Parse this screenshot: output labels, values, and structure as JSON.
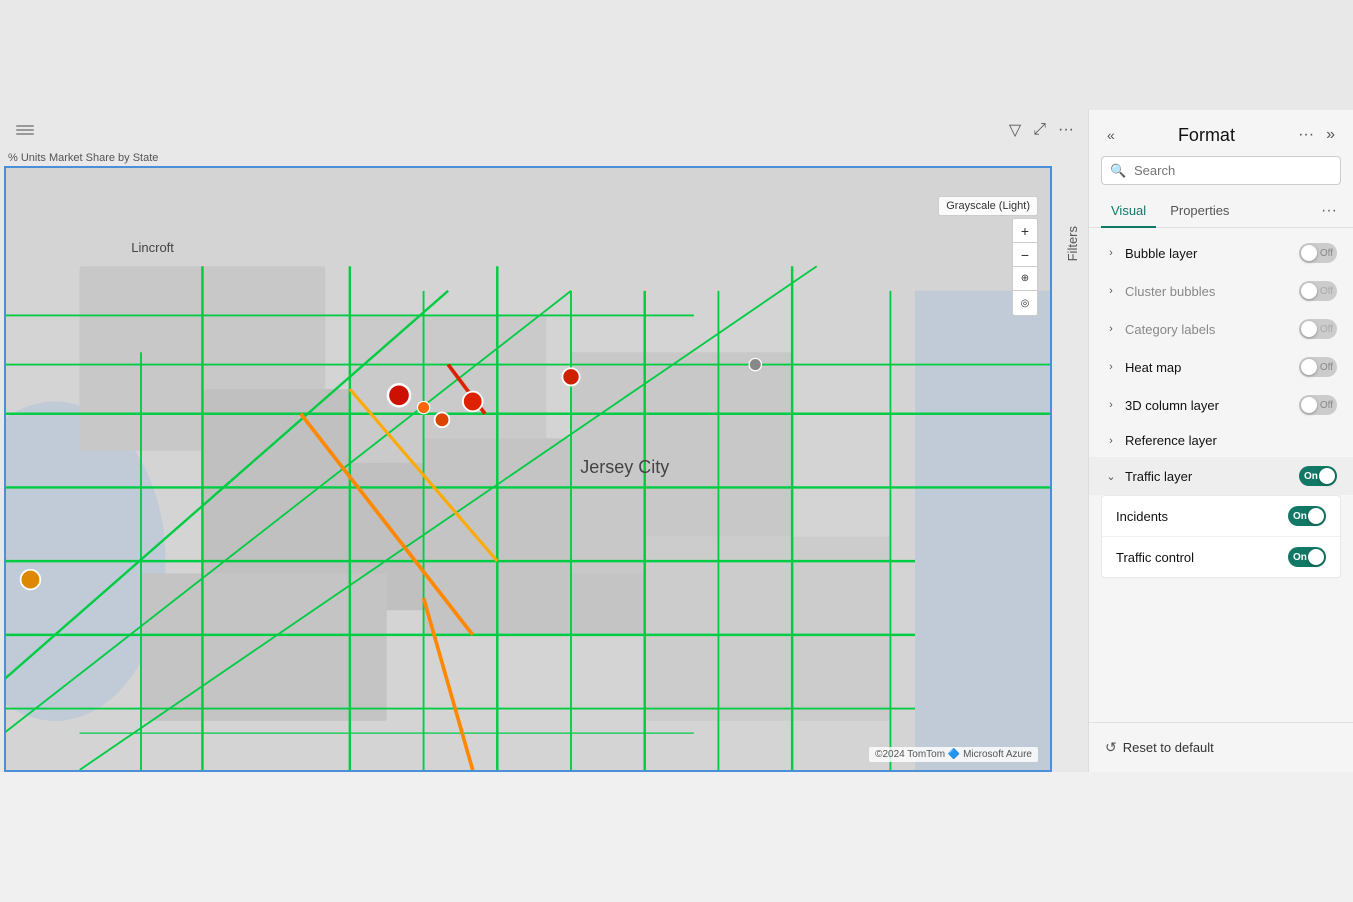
{
  "format_panel": {
    "title": "Format",
    "search_placeholder": "Search",
    "tabs": [
      {
        "id": "visual",
        "label": "Visual",
        "active": true
      },
      {
        "id": "properties",
        "label": "Properties",
        "active": false
      }
    ],
    "tab_more": "···",
    "layers": [
      {
        "id": "bubble_layer",
        "name": "Bubble layer",
        "state": "off",
        "expanded": false,
        "dimmed": false
      },
      {
        "id": "cluster_bubbles",
        "name": "Cluster bubbles",
        "state": "off",
        "expanded": false,
        "dimmed": true
      },
      {
        "id": "category_labels",
        "name": "Category labels",
        "state": "off",
        "expanded": false,
        "dimmed": true
      },
      {
        "id": "heat_map",
        "name": "Heat map",
        "state": "off",
        "expanded": false,
        "dimmed": false
      },
      {
        "id": "3d_column_layer",
        "name": "3D column layer",
        "state": "off",
        "expanded": false,
        "dimmed": false
      },
      {
        "id": "reference_layer",
        "name": "Reference layer",
        "state": null,
        "expanded": false,
        "dimmed": false
      },
      {
        "id": "traffic_layer",
        "name": "Traffic layer",
        "state": "on",
        "expanded": true,
        "dimmed": false
      }
    ],
    "traffic_sub": [
      {
        "id": "incidents",
        "name": "Incidents",
        "state": "on"
      },
      {
        "id": "traffic_control",
        "name": "Traffic control",
        "state": "on"
      }
    ],
    "reset_btn": "Reset to default",
    "header_icons": {
      "more": "···",
      "collapse": "»",
      "back": "«"
    }
  },
  "map": {
    "label": "% Units Market Share by State",
    "overlay": "Grayscale (Light)",
    "city_label": "Jersey City",
    "lincroft_label": "Lincroft",
    "footer": "©2024 TomTom    🔷 Microsoft Azure",
    "zoom_in": "+",
    "zoom_out": "−"
  },
  "filters_strip": {
    "label": "Filters"
  },
  "toolbar": {
    "drag_handle": true,
    "filter_icon": "▽",
    "expand_icon": "⤢",
    "more_icon": "···"
  }
}
